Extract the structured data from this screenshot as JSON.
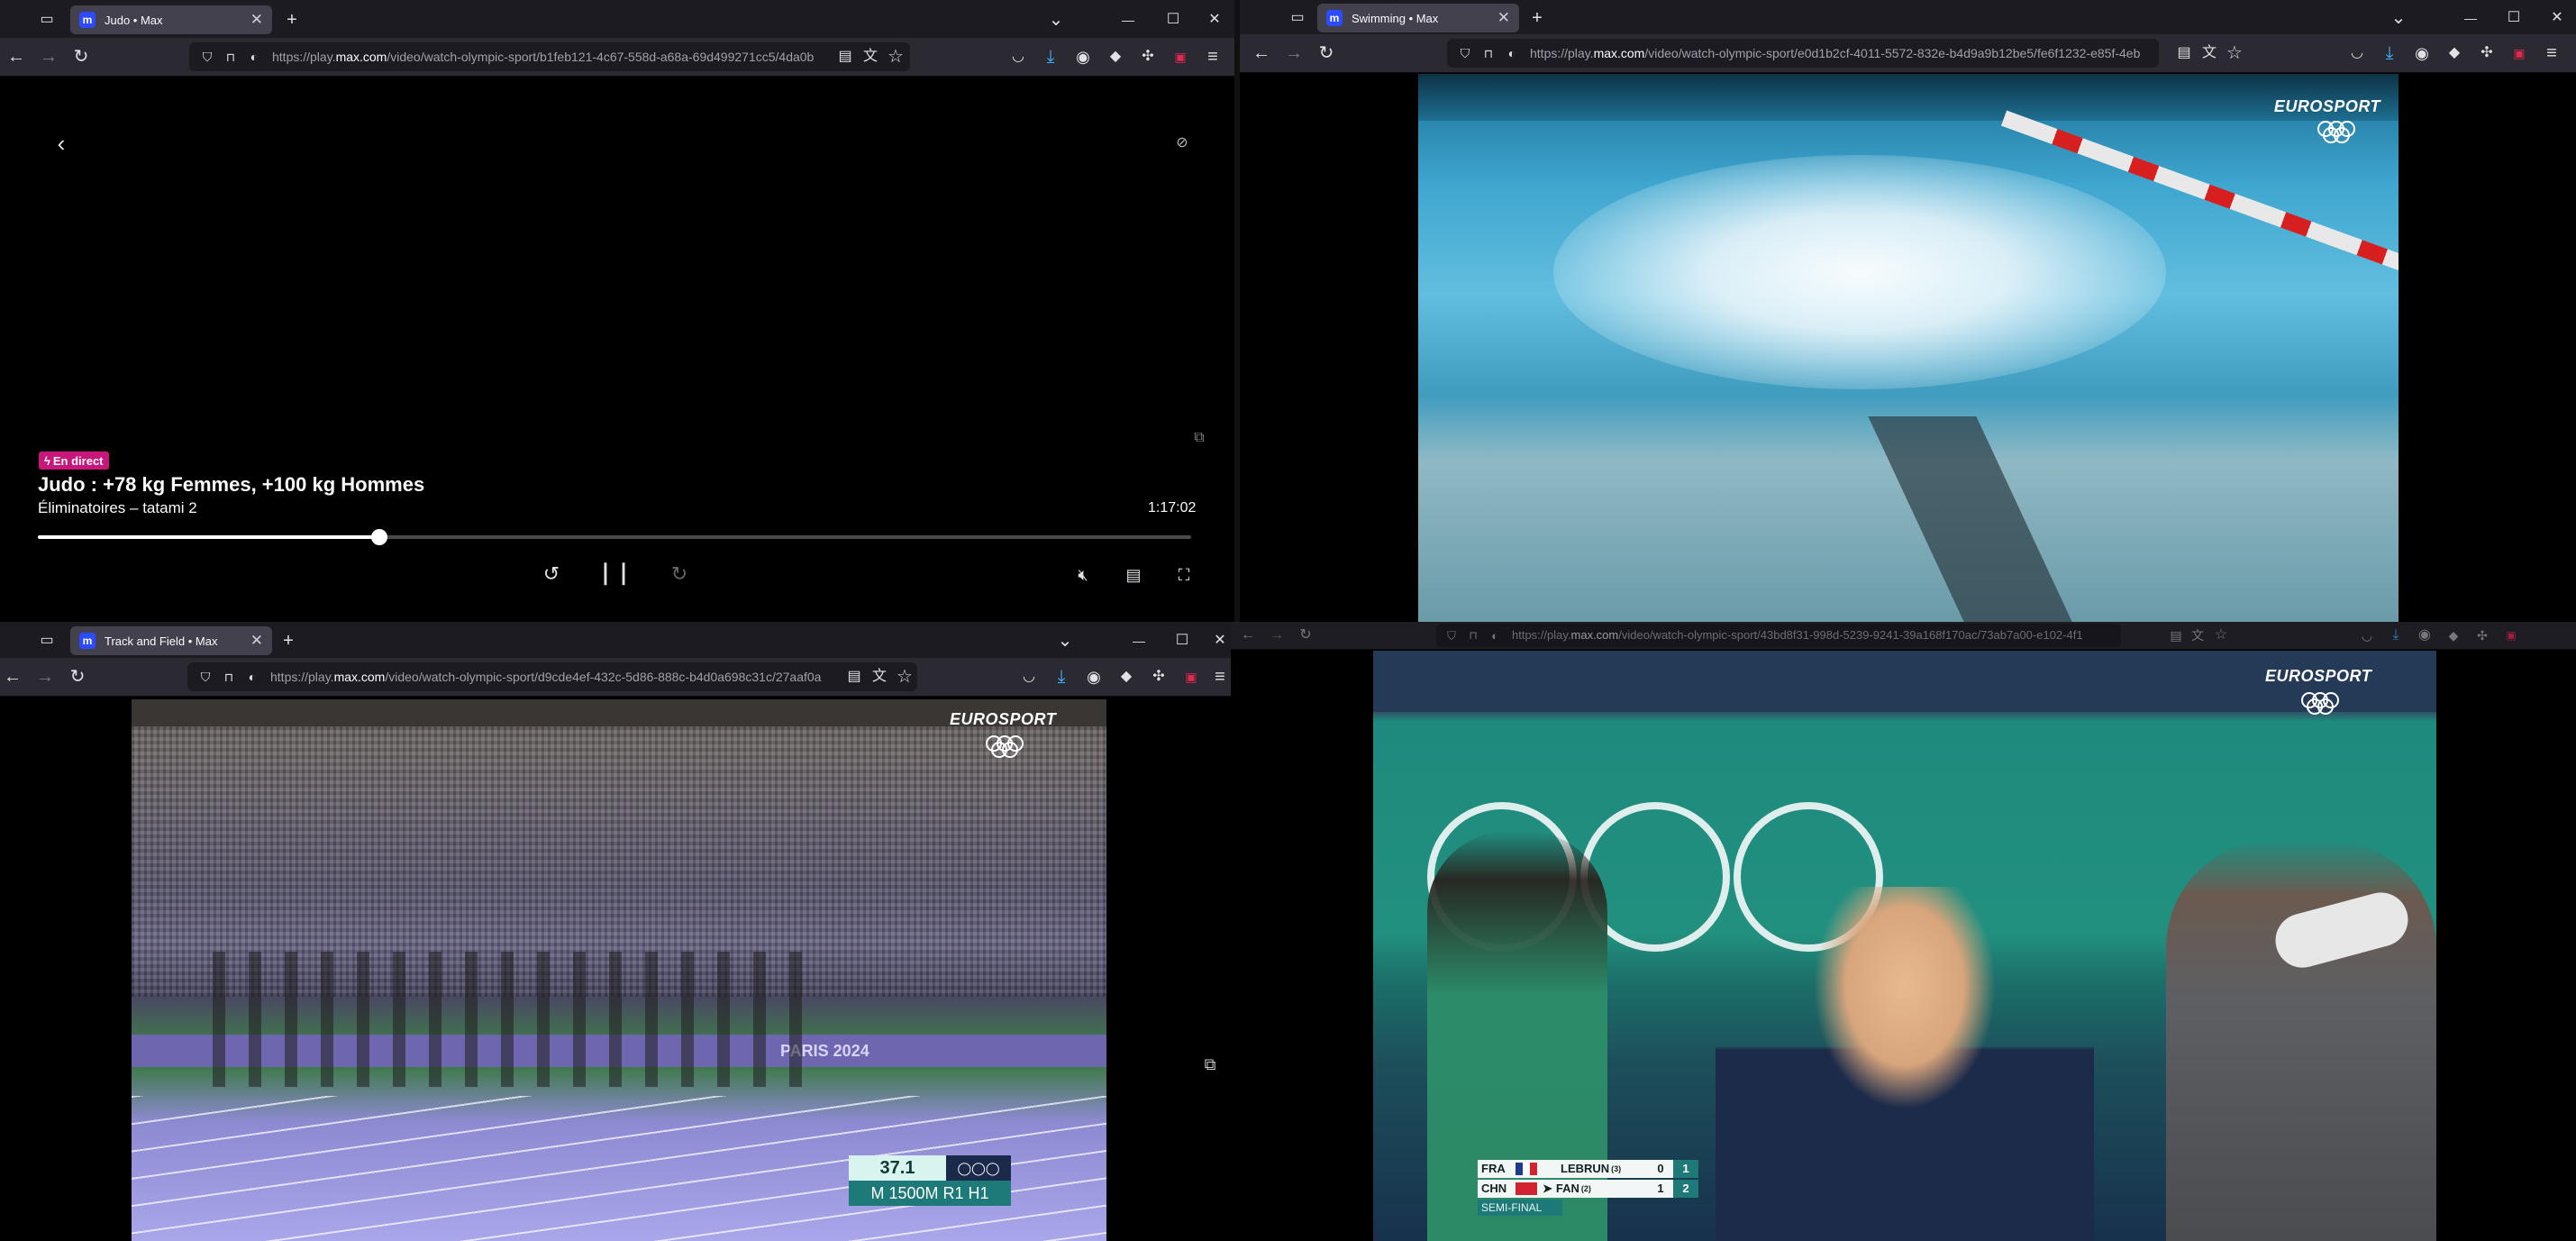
{
  "windows": {
    "judo": {
      "tab_title": "Judo • Max",
      "favicon": "m",
      "url_prefix": "https://play.",
      "url_domain": "max.com",
      "url_rest": "/video/watch-olympic-sport/b1feb121-4c67-558d-a68a-69d499271cc5/4da0b",
      "player": {
        "live_badge": "En direct",
        "title": "Judo : +78 kg Femmes, +100 kg Hommes",
        "subtitle": "Éliminatoires – tatami 2",
        "time": "1:17:02",
        "progress_fraction": 0.296
      }
    },
    "swimming": {
      "tab_title": "Swimming • Max",
      "favicon": "m",
      "url_prefix": "https://play.",
      "url_domain": "max.com",
      "url_rest": "/video/watch-olympic-sport/e0d1b2cf-4011-5572-832e-b4d9a9b12be5/fe6f1232-e85f-4eb",
      "broadcaster": "EUROSPORT"
    },
    "track": {
      "tab_title": "Track and Field • Max",
      "favicon": "m",
      "url_prefix": "https://play.",
      "url_domain": "max.com",
      "url_rest": "/video/watch-olympic-sport/d9cde4ef-432c-5d86-888c-b4d0a698c31c/27aaf0a",
      "broadcaster": "EUROSPORT",
      "overlay_time": "37.1",
      "overlay_event": "M 1500M R1 H1",
      "banner_text": "PARIS 2024"
    },
    "tabletennis": {
      "url_prefix": "https://play.",
      "url_domain": "max.com",
      "url_rest": "/video/watch-olympic-sport/43bd8f31-998d-5239-9241-39a168f170ac/73ab7a00-e102-4f1",
      "broadcaster": "EUROSPORT",
      "score": {
        "rows": [
          {
            "country": "FRA",
            "name": "LEBRUN",
            "seed": "(3)",
            "games": "0",
            "points": "1"
          },
          {
            "country": "CHN",
            "name": "FAN",
            "seed": "(2)",
            "games": "1",
            "points": "2"
          }
        ],
        "stage": "SEMI-FINAL"
      }
    }
  },
  "icons": {
    "back": "←",
    "forward": "→",
    "reload": "↻",
    "add_tab": "+",
    "list_tabs": "⌄",
    "minimize": "—",
    "maximize": "☐",
    "close": "✕",
    "menu": "≡",
    "star": "☆",
    "download": "⤓",
    "lock": "🔒"
  }
}
